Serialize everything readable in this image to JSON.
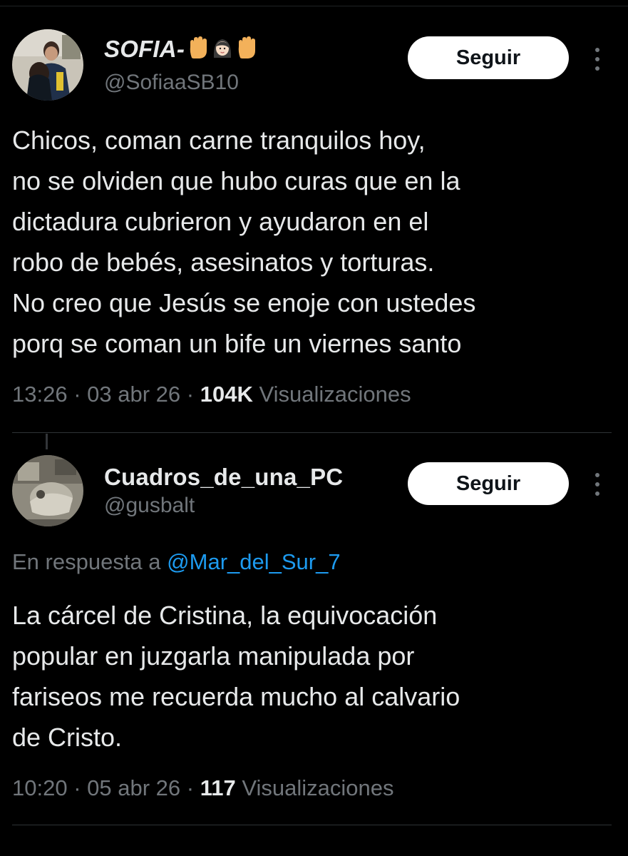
{
  "tweets": [
    {
      "author_name": "SOFIA-",
      "author_emoji": [
        "raised-hand-icon",
        "woman-face-icon",
        "raised-hand-icon"
      ],
      "author_handle": "@SofiaaSB10",
      "follow_label": "Seguir",
      "body_lines": [
        "Chicos, coman carne tranquilos hoy,",
        "no se olviden que hubo curas que en la",
        "dictadura cubrieron y ayudaron en el",
        "robo de bebés, asesinatos y torturas.",
        "No creo que Jesús se enoje con ustedes",
        "porq se coman un bife un viernes santo"
      ],
      "time": "13:26",
      "date": "03 abr 26",
      "views_count": "104K",
      "views_label": "Visualizaciones"
    },
    {
      "author_name": "Cuadros_de_una_PC",
      "author_handle": "@gusbalt",
      "follow_label": "Seguir",
      "reply_prefix": "En respuesta a",
      "reply_handle": "@Mar_del_Sur_7",
      "body_lines": [
        "La cárcel de Cristina, la equivocación",
        "popular en juzgarla manipulada por",
        "fariseos me recuerda mucho al calvario",
        "de Cristo."
      ],
      "time": "10:20",
      "date": "05 abr 26",
      "views_count": "117",
      "views_label": "Visualizaciones"
    }
  ],
  "separator": "·",
  "colors": {
    "background": "#000000",
    "text": "#e7e9ea",
    "muted": "#71767b",
    "link": "#1d9bf0",
    "button_bg": "#ffffff",
    "button_text": "#0f1419"
  }
}
